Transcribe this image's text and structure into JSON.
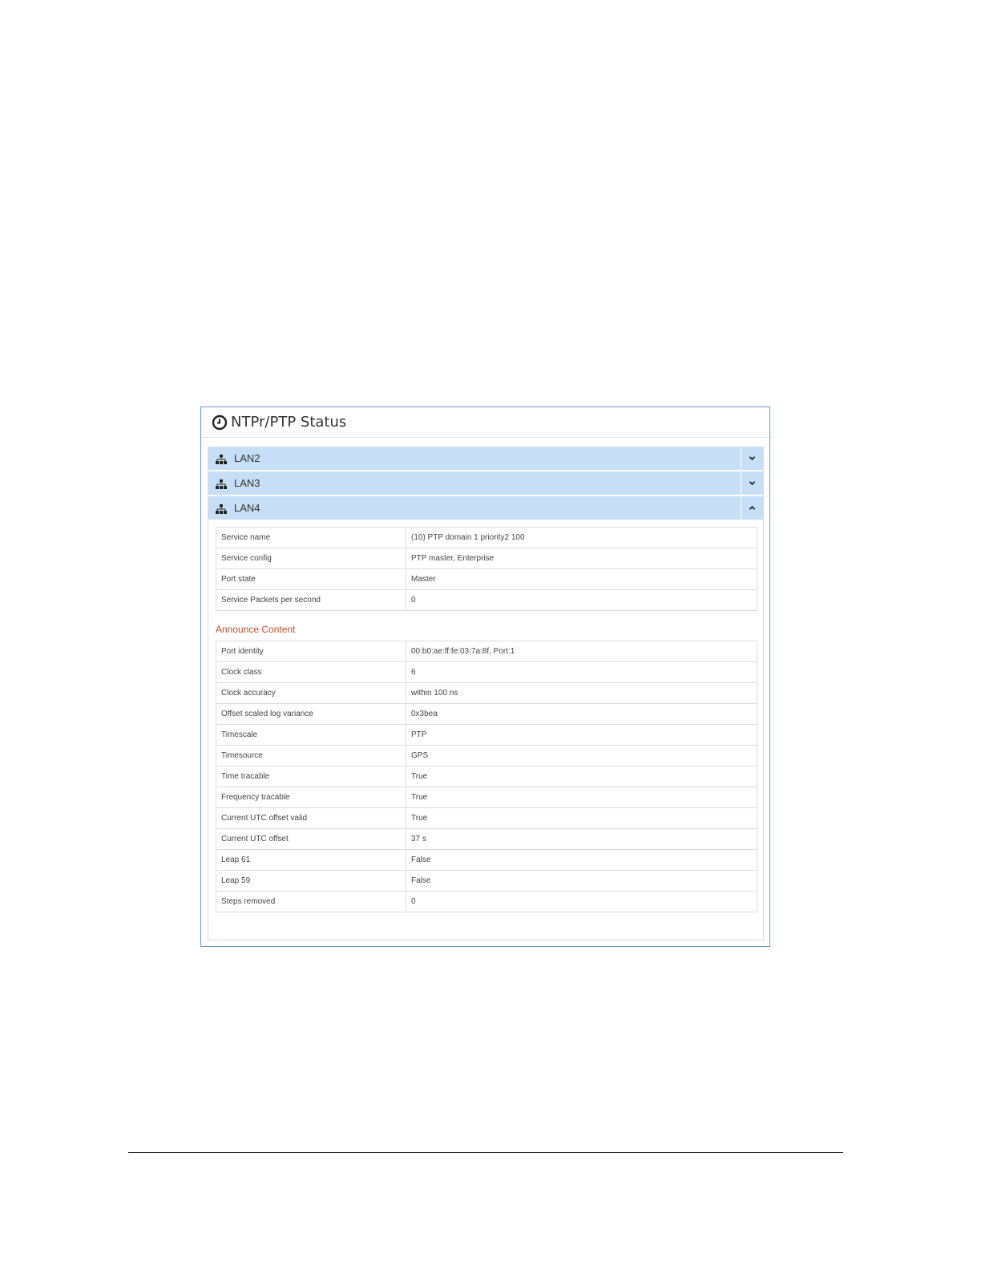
{
  "panel": {
    "title": "NTPr/PTP Status",
    "icon": "clock-icon"
  },
  "accordions": [
    {
      "label": "LAN2",
      "expanded": false,
      "icon": "network-icon"
    },
    {
      "label": "LAN3",
      "expanded": false,
      "icon": "network-icon"
    },
    {
      "label": "LAN4",
      "expanded": true,
      "icon": "network-icon"
    }
  ],
  "service": [
    {
      "key": "Service name",
      "value": "(10) PTP domain 1 priority2 100"
    },
    {
      "key": "Service config",
      "value": "PTP master, Enterprise"
    },
    {
      "key": "Port state",
      "value": "Master"
    },
    {
      "key": "Service Packets per second",
      "value": "0"
    }
  ],
  "announce": {
    "title": "Announce Content",
    "rows": [
      {
        "key": "Port identity",
        "value": "00:b0:ae:ff:fe:03:7a:8f, Port:1"
      },
      {
        "key": "Clock class",
        "value": "6"
      },
      {
        "key": "Clock accuracy",
        "value": "within 100 ns"
      },
      {
        "key": "Offset scaled log variance",
        "value": "0x3bea"
      },
      {
        "key": "Timescale",
        "value": "PTP"
      },
      {
        "key": "Timesource",
        "value": "GPS"
      },
      {
        "key": "Time tracable",
        "value": "True"
      },
      {
        "key": "Frequency tracable",
        "value": "True"
      },
      {
        "key": "Current UTC offset valid",
        "value": "True"
      },
      {
        "key": "Current UTC offset",
        "value": "37 s"
      },
      {
        "key": "Leap 61",
        "value": "False"
      },
      {
        "key": "Leap 59",
        "value": "False"
      },
      {
        "key": "Steps removed",
        "value": "0"
      }
    ]
  },
  "colors": {
    "accordion_bg": "#c6dff6",
    "panel_border": "#6d95c9",
    "section_title": "#c0502f"
  }
}
